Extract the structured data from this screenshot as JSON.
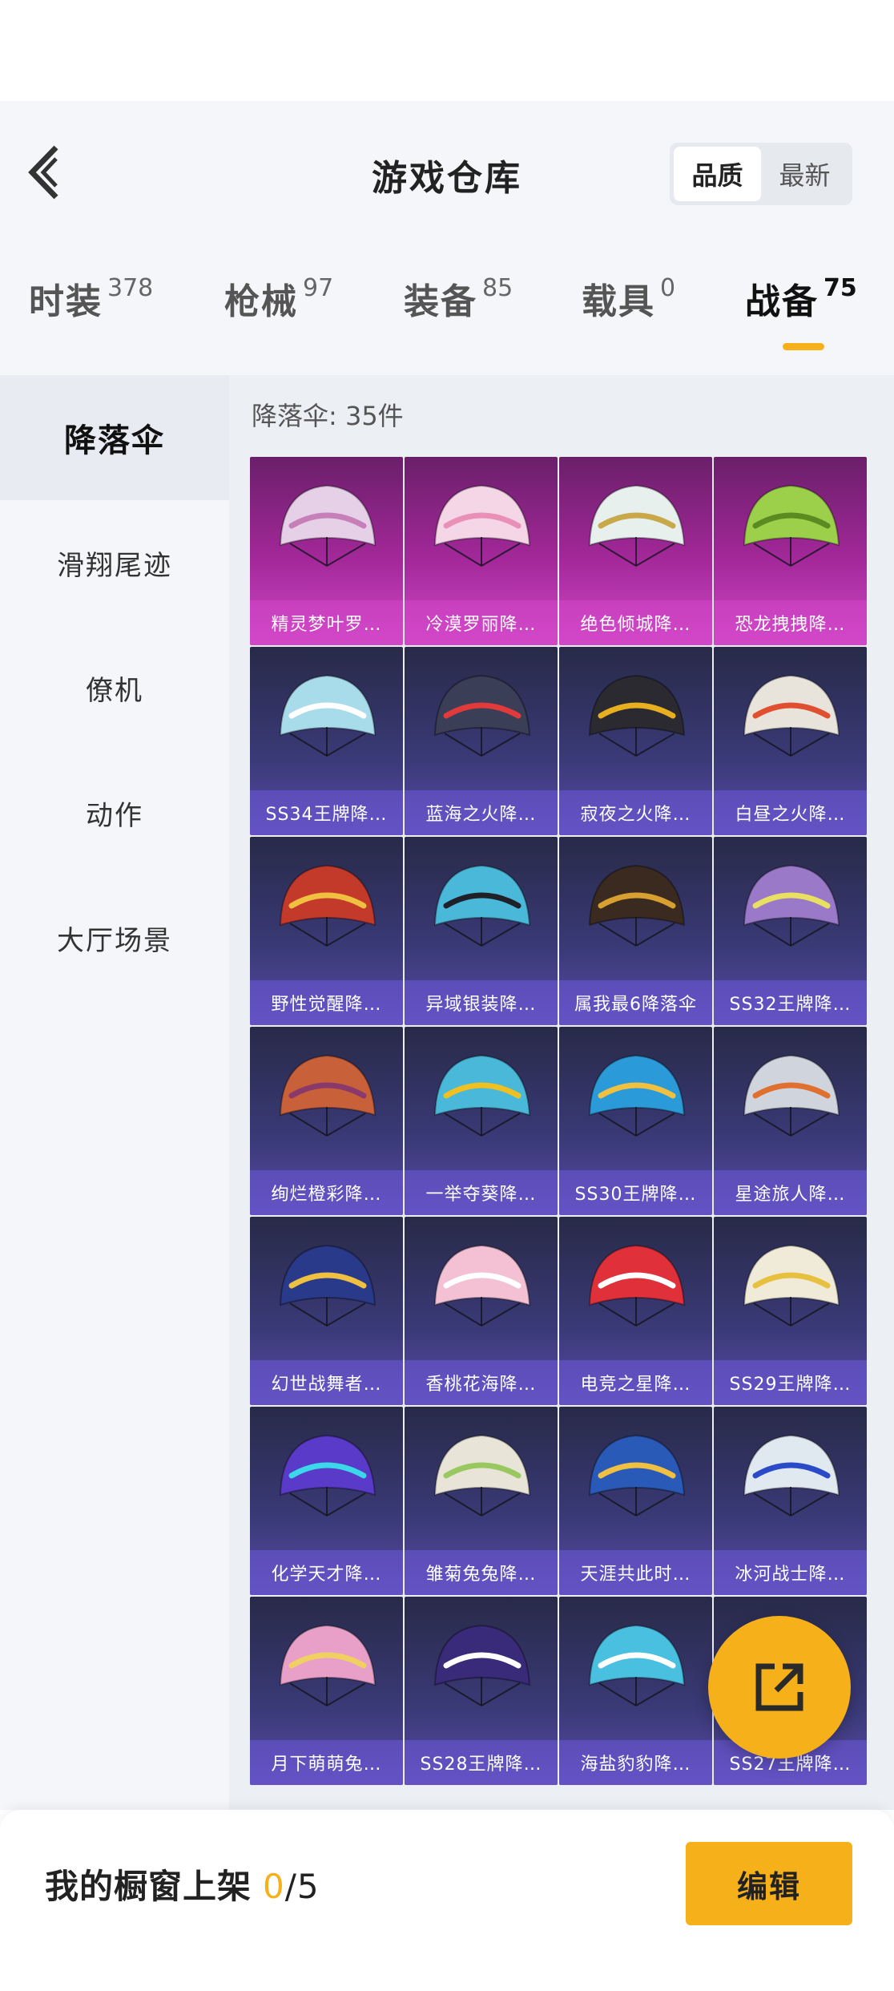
{
  "header": {
    "title": "游戏仓库",
    "sort_options": [
      {
        "label": "品质",
        "active": true
      },
      {
        "label": "最新",
        "active": false
      }
    ]
  },
  "tabs": [
    {
      "label": "时装",
      "count": "378",
      "active": false
    },
    {
      "label": "枪械",
      "count": "97",
      "active": false
    },
    {
      "label": "装备",
      "count": "85",
      "active": false
    },
    {
      "label": "载具",
      "count": "0",
      "active": false
    },
    {
      "label": "战备",
      "count": "75",
      "active": true
    }
  ],
  "sidebar": {
    "items": [
      {
        "label": "降落伞",
        "active": true
      },
      {
        "label": "滑翔尾迹",
        "active": false
      },
      {
        "label": "僚机",
        "active": false
      },
      {
        "label": "动作",
        "active": false
      },
      {
        "label": "大厅场景",
        "active": false
      }
    ]
  },
  "content": {
    "count_label": "降落伞: 35件"
  },
  "items": [
    {
      "name": "精灵梦叶罗…",
      "rarity": "legendary",
      "color": "#e6d0e8",
      "accent": "#c77fb8"
    },
    {
      "name": "冷漠罗丽降…",
      "rarity": "legendary",
      "color": "#f4d6e6",
      "accent": "#e890b8"
    },
    {
      "name": "绝色倾城降…",
      "rarity": "legendary",
      "color": "#e8f0ee",
      "accent": "#c9a84a"
    },
    {
      "name": "恐龙拽拽降…",
      "rarity": "legendary",
      "color": "#9ccf4a",
      "accent": "#5a8a20"
    },
    {
      "name": "SS34王牌降…",
      "rarity": "epic",
      "color": "#a8dcea",
      "accent": "#ffffff"
    },
    {
      "name": "蓝海之火降…",
      "rarity": "epic",
      "color": "#3a3e56",
      "accent": "#e03a3a"
    },
    {
      "name": "寂夜之火降…",
      "rarity": "epic",
      "color": "#2a2a30",
      "accent": "#e8b020"
    },
    {
      "name": "白昼之火降…",
      "rarity": "epic",
      "color": "#e8e4dc",
      "accent": "#e05030"
    },
    {
      "name": "野性觉醒降…",
      "rarity": "epic",
      "color": "#c43a2a",
      "accent": "#f0c040"
    },
    {
      "name": "异域银装降…",
      "rarity": "epic",
      "color": "#4ab8d8",
      "accent": "#202028"
    },
    {
      "name": "属我最6降落伞",
      "rarity": "epic",
      "color": "#3a2a20",
      "accent": "#d8a030"
    },
    {
      "name": "SS32王牌降…",
      "rarity": "epic",
      "color": "#9a7ac8",
      "accent": "#e8e060"
    },
    {
      "name": "绚烂橙彩降…",
      "rarity": "epic",
      "color": "#c8603a",
      "accent": "#8a3a6a"
    },
    {
      "name": "一举夺葵降…",
      "rarity": "epic",
      "color": "#4ab8d8",
      "accent": "#f0c020"
    },
    {
      "name": "SS30王牌降…",
      "rarity": "epic",
      "color": "#2a9ad8",
      "accent": "#f0c040"
    },
    {
      "name": "星途旅人降…",
      "rarity": "epic",
      "color": "#d0d4dc",
      "accent": "#e07030"
    },
    {
      "name": "幻世战舞者…",
      "rarity": "epic",
      "color": "#2a3a8a",
      "accent": "#f0c040"
    },
    {
      "name": "香桃花海降…",
      "rarity": "epic",
      "color": "#f4c0d4",
      "accent": "#ffffff"
    },
    {
      "name": "电竞之星降…",
      "rarity": "epic",
      "color": "#e0303a",
      "accent": "#ffffff"
    },
    {
      "name": "SS29王牌降…",
      "rarity": "epic",
      "color": "#f0ead8",
      "accent": "#e8c040"
    },
    {
      "name": "化学天才降…",
      "rarity": "epic",
      "color": "#5a3ac8",
      "accent": "#3ad8e8"
    },
    {
      "name": "雏菊兔兔降…",
      "rarity": "epic",
      "color": "#e8e4d8",
      "accent": "#9ac860"
    },
    {
      "name": "天涯共此时…",
      "rarity": "epic",
      "color": "#2a5ab8",
      "accent": "#f0c040"
    },
    {
      "name": "冰河战士降…",
      "rarity": "epic",
      "color": "#e0e8f0",
      "accent": "#2a4ac8"
    },
    {
      "name": "月下萌萌兔…",
      "rarity": "epic",
      "color": "#e8a0c8",
      "accent": "#f0d060"
    },
    {
      "name": "SS28王牌降…",
      "rarity": "epic",
      "color": "#3a2a7a",
      "accent": "#ffffff"
    },
    {
      "name": "海盐豹豹降…",
      "rarity": "epic",
      "color": "#4ac0e0",
      "accent": "#ffffff"
    },
    {
      "name": "SS27王牌降…",
      "rarity": "epic",
      "color": "#e0a040",
      "accent": "#3a3a8a"
    }
  ],
  "showcase": {
    "label": "我的橱窗上架",
    "current": "0",
    "separator": "/",
    "max": "5"
  },
  "edit_button": "编辑",
  "colors": {
    "accent": "#f5b01a",
    "legendary_card": "#a4289a",
    "epic_card": "#3a3a78",
    "background": "#f4f6f9"
  },
  "icons": {
    "back": "back-arrow-icon",
    "fab": "share-icon"
  }
}
